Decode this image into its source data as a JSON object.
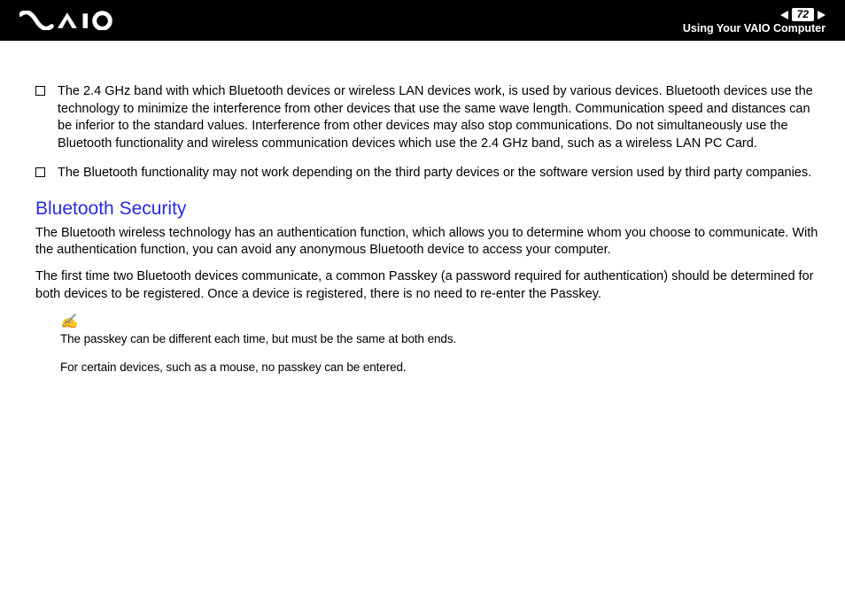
{
  "header": {
    "page_number": "72",
    "title": "Using Your VAIO Computer"
  },
  "bullets": [
    "The 2.4 GHz band with which Bluetooth devices or wireless LAN devices work, is used by various devices. Bluetooth devices use the technology to minimize the interference from other devices that use the same wave length. Communication speed and distances can be inferior to the standard values. Interference from other devices may also stop communications. Do not simultaneously use the Bluetooth functionality and wireless communication devices which use the 2.4 GHz band, such as a wireless LAN PC Card.",
    "The Bluetooth functionality may not work depending on the third party devices or the software version used by third party companies."
  ],
  "section": {
    "heading": "Bluetooth Security",
    "para1": "The Bluetooth wireless technology has an authentication function, which allows you to determine whom you choose to communicate. With the authentication function, you can avoid any anonymous Bluetooth device to access your computer.",
    "para2": "The first time two Bluetooth devices communicate, a common Passkey (a password required for authentication) should be determined for both devices to be registered. Once a device is registered, there is no need to re-enter the Passkey."
  },
  "notes": {
    "line1": "The passkey can be different each time, but must be the same at both ends.",
    "line2": "For certain devices, such as a mouse, no passkey can be entered."
  }
}
